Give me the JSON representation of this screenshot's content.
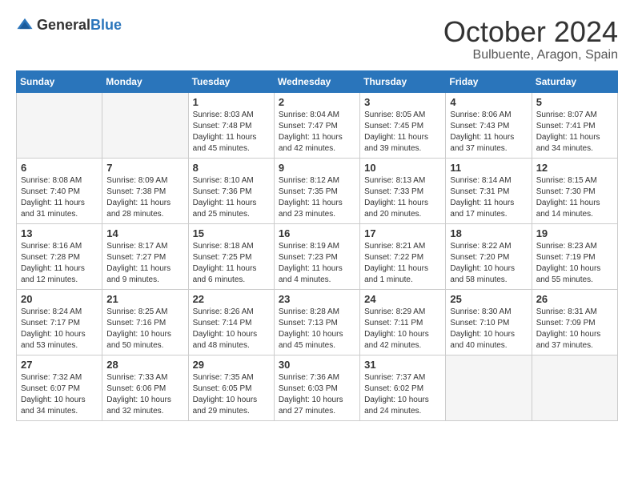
{
  "header": {
    "logo_general": "General",
    "logo_blue": "Blue",
    "month": "October 2024",
    "location": "Bulbuente, Aragon, Spain"
  },
  "weekdays": [
    "Sunday",
    "Monday",
    "Tuesday",
    "Wednesday",
    "Thursday",
    "Friday",
    "Saturday"
  ],
  "weeks": [
    [
      {
        "day": "",
        "text": ""
      },
      {
        "day": "",
        "text": ""
      },
      {
        "day": "1",
        "text": "Sunrise: 8:03 AM\nSunset: 7:48 PM\nDaylight: 11 hours and 45 minutes."
      },
      {
        "day": "2",
        "text": "Sunrise: 8:04 AM\nSunset: 7:47 PM\nDaylight: 11 hours and 42 minutes."
      },
      {
        "day": "3",
        "text": "Sunrise: 8:05 AM\nSunset: 7:45 PM\nDaylight: 11 hours and 39 minutes."
      },
      {
        "day": "4",
        "text": "Sunrise: 8:06 AM\nSunset: 7:43 PM\nDaylight: 11 hours and 37 minutes."
      },
      {
        "day": "5",
        "text": "Sunrise: 8:07 AM\nSunset: 7:41 PM\nDaylight: 11 hours and 34 minutes."
      }
    ],
    [
      {
        "day": "6",
        "text": "Sunrise: 8:08 AM\nSunset: 7:40 PM\nDaylight: 11 hours and 31 minutes."
      },
      {
        "day": "7",
        "text": "Sunrise: 8:09 AM\nSunset: 7:38 PM\nDaylight: 11 hours and 28 minutes."
      },
      {
        "day": "8",
        "text": "Sunrise: 8:10 AM\nSunset: 7:36 PM\nDaylight: 11 hours and 25 minutes."
      },
      {
        "day": "9",
        "text": "Sunrise: 8:12 AM\nSunset: 7:35 PM\nDaylight: 11 hours and 23 minutes."
      },
      {
        "day": "10",
        "text": "Sunrise: 8:13 AM\nSunset: 7:33 PM\nDaylight: 11 hours and 20 minutes."
      },
      {
        "day": "11",
        "text": "Sunrise: 8:14 AM\nSunset: 7:31 PM\nDaylight: 11 hours and 17 minutes."
      },
      {
        "day": "12",
        "text": "Sunrise: 8:15 AM\nSunset: 7:30 PM\nDaylight: 11 hours and 14 minutes."
      }
    ],
    [
      {
        "day": "13",
        "text": "Sunrise: 8:16 AM\nSunset: 7:28 PM\nDaylight: 11 hours and 12 minutes."
      },
      {
        "day": "14",
        "text": "Sunrise: 8:17 AM\nSunset: 7:27 PM\nDaylight: 11 hours and 9 minutes."
      },
      {
        "day": "15",
        "text": "Sunrise: 8:18 AM\nSunset: 7:25 PM\nDaylight: 11 hours and 6 minutes."
      },
      {
        "day": "16",
        "text": "Sunrise: 8:19 AM\nSunset: 7:23 PM\nDaylight: 11 hours and 4 minutes."
      },
      {
        "day": "17",
        "text": "Sunrise: 8:21 AM\nSunset: 7:22 PM\nDaylight: 11 hours and 1 minute."
      },
      {
        "day": "18",
        "text": "Sunrise: 8:22 AM\nSunset: 7:20 PM\nDaylight: 10 hours and 58 minutes."
      },
      {
        "day": "19",
        "text": "Sunrise: 8:23 AM\nSunset: 7:19 PM\nDaylight: 10 hours and 55 minutes."
      }
    ],
    [
      {
        "day": "20",
        "text": "Sunrise: 8:24 AM\nSunset: 7:17 PM\nDaylight: 10 hours and 53 minutes."
      },
      {
        "day": "21",
        "text": "Sunrise: 8:25 AM\nSunset: 7:16 PM\nDaylight: 10 hours and 50 minutes."
      },
      {
        "day": "22",
        "text": "Sunrise: 8:26 AM\nSunset: 7:14 PM\nDaylight: 10 hours and 48 minutes."
      },
      {
        "day": "23",
        "text": "Sunrise: 8:28 AM\nSunset: 7:13 PM\nDaylight: 10 hours and 45 minutes."
      },
      {
        "day": "24",
        "text": "Sunrise: 8:29 AM\nSunset: 7:11 PM\nDaylight: 10 hours and 42 minutes."
      },
      {
        "day": "25",
        "text": "Sunrise: 8:30 AM\nSunset: 7:10 PM\nDaylight: 10 hours and 40 minutes."
      },
      {
        "day": "26",
        "text": "Sunrise: 8:31 AM\nSunset: 7:09 PM\nDaylight: 10 hours and 37 minutes."
      }
    ],
    [
      {
        "day": "27",
        "text": "Sunrise: 7:32 AM\nSunset: 6:07 PM\nDaylight: 10 hours and 34 minutes."
      },
      {
        "day": "28",
        "text": "Sunrise: 7:33 AM\nSunset: 6:06 PM\nDaylight: 10 hours and 32 minutes."
      },
      {
        "day": "29",
        "text": "Sunrise: 7:35 AM\nSunset: 6:05 PM\nDaylight: 10 hours and 29 minutes."
      },
      {
        "day": "30",
        "text": "Sunrise: 7:36 AM\nSunset: 6:03 PM\nDaylight: 10 hours and 27 minutes."
      },
      {
        "day": "31",
        "text": "Sunrise: 7:37 AM\nSunset: 6:02 PM\nDaylight: 10 hours and 24 minutes."
      },
      {
        "day": "",
        "text": ""
      },
      {
        "day": "",
        "text": ""
      }
    ]
  ]
}
